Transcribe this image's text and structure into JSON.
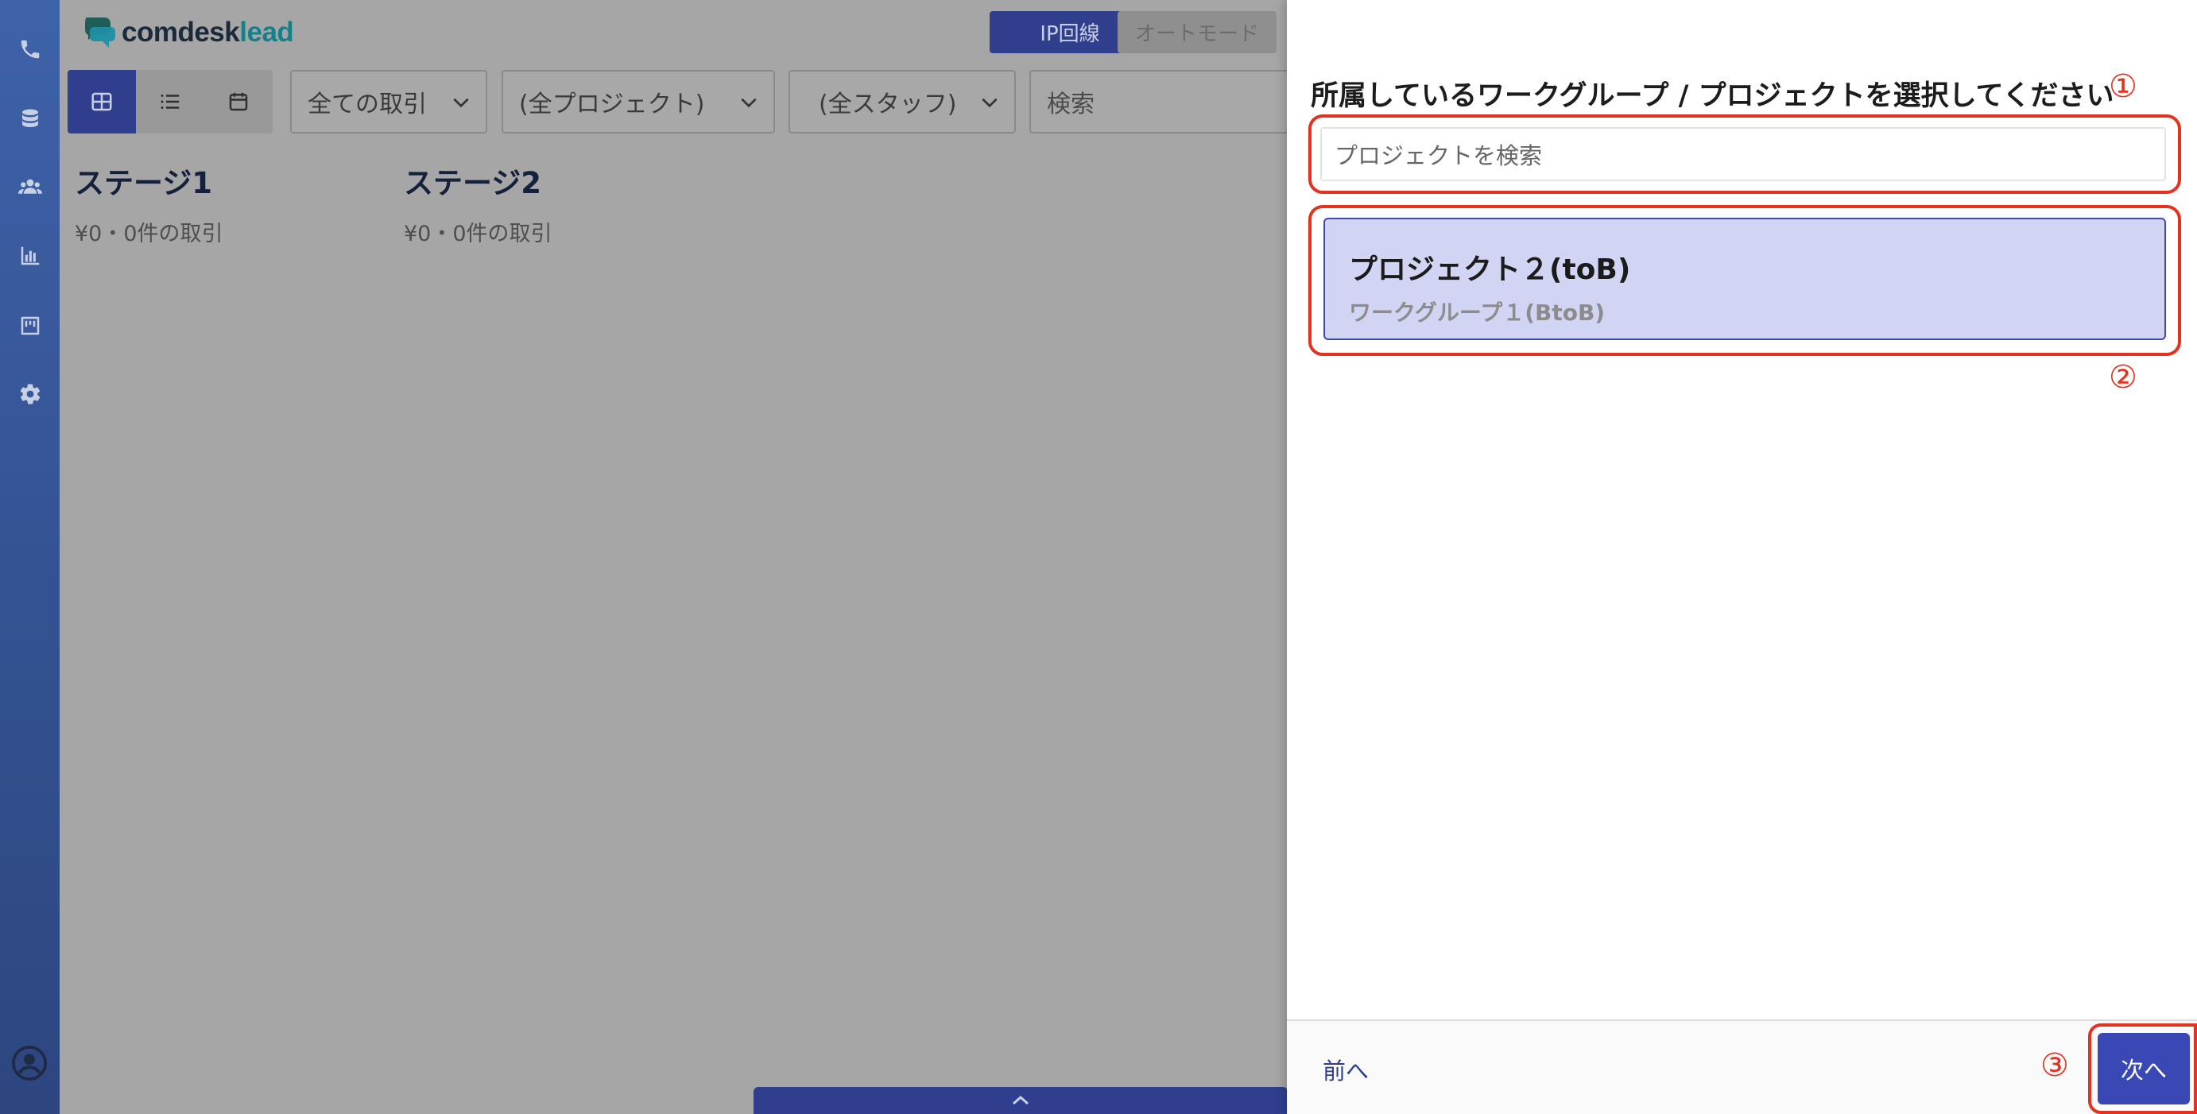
{
  "brand": {
    "name_part1": "comdesk",
    "name_part2": "lead"
  },
  "topbar": {
    "ip_button": "IP回線",
    "auto_mode_button": "オートモード"
  },
  "filters": {
    "deals": "全ての取引",
    "projects": "(全プロジェクト)",
    "staff": "(全スタッフ)",
    "search_placeholder": "検索"
  },
  "stages": [
    {
      "title": "ステージ1",
      "summary": "¥0・0件の取引"
    },
    {
      "title": "ステージ2",
      "summary": "¥0・0件の取引"
    }
  ],
  "panel": {
    "title": "所属しているワークグループ / プロジェクトを選択してください",
    "search_placeholder": "プロジェクトを検索",
    "project": {
      "name": "プロジェクト２(toB)",
      "group": "ワークグループ１(BtoB)"
    },
    "prev_label": "前へ",
    "next_label": "次へ"
  },
  "annotations": {
    "m1": "①",
    "m2": "②",
    "m3": "③"
  },
  "sidebar_icons": [
    "phone-icon",
    "database-icon",
    "users-icon",
    "chart-icon",
    "board-icon",
    "gear-icon",
    "account-icon"
  ],
  "colors": {
    "accent": "#3a48b5",
    "annotation": "#e3321f",
    "selected_card": "#d2d4f3",
    "sidebar": "#3e62a8"
  }
}
